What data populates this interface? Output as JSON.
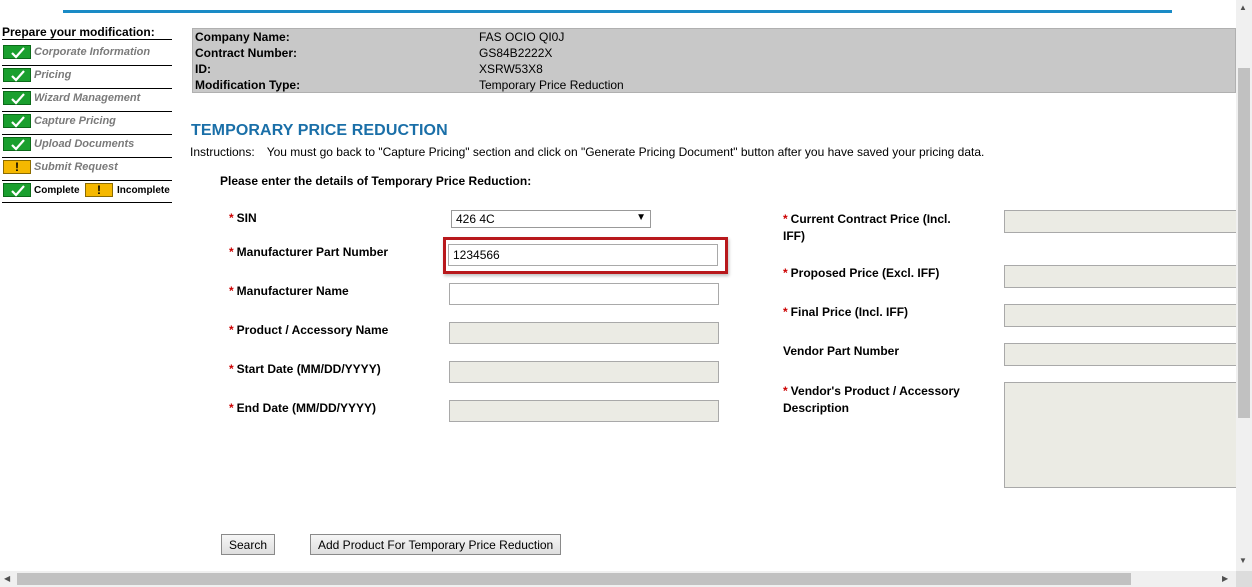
{
  "sidebar": {
    "title": "Prepare your modification:",
    "items": [
      {
        "label": "Corporate Information",
        "status": "complete"
      },
      {
        "label": "Pricing",
        "status": "complete"
      },
      {
        "label": "Wizard Management",
        "status": "complete"
      },
      {
        "label": "Capture Pricing",
        "status": "complete"
      },
      {
        "label": "Upload Documents",
        "status": "complete"
      },
      {
        "label": "Submit Request",
        "status": "incomplete"
      }
    ],
    "legend": {
      "complete": "Complete",
      "incomplete": "Incomplete"
    }
  },
  "info": {
    "company_label": "Company Name:",
    "company_value": "FAS OCIO QI0J",
    "contract_label": "Contract Number:",
    "contract_value": "GS84B2222X",
    "id_label": "ID:",
    "id_value": "XSRW53X8",
    "modtype_label": "Modification Type:",
    "modtype_value": "Temporary Price Reduction"
  },
  "heading": "TEMPORARY PRICE REDUCTION",
  "instructions": {
    "label": "Instructions:",
    "text": "You must go back to \"Capture Pricing\" section and click on \"Generate Pricing Document\" button after you have saved your pricing data."
  },
  "subheading": "Please enter the details of Temporary Price Reduction:",
  "form": {
    "sin_label": "SIN",
    "sin_value": "426 4C",
    "mpn_label": "Manufacturer Part Number",
    "mpn_value": "1234566",
    "mname_label": "Manufacturer Name",
    "mname_value": "",
    "product_label": "Product / Accessory Name",
    "start_label": "Start Date (MM/DD/YYYY)",
    "end_label": "End Date (MM/DD/YYYY)",
    "current_price_label": "Current Contract Price (Incl. IFF)",
    "proposed_price_label": "Proposed Price (Excl. IFF)",
    "final_price_label": "Final Price (Incl. IFF)",
    "vendor_pn_label": "Vendor Part Number",
    "vendor_desc_label": "Vendor's Product / Accessory Description",
    "required_mark": "*"
  },
  "buttons": {
    "search": "Search",
    "add": "Add Product For Temporary Price Reduction"
  },
  "colors": {
    "accent": "#1a6fa8",
    "complete": "#1a9f2e",
    "incomplete": "#f5b800",
    "highlight": "#b8181c",
    "required": "#cc0000"
  }
}
